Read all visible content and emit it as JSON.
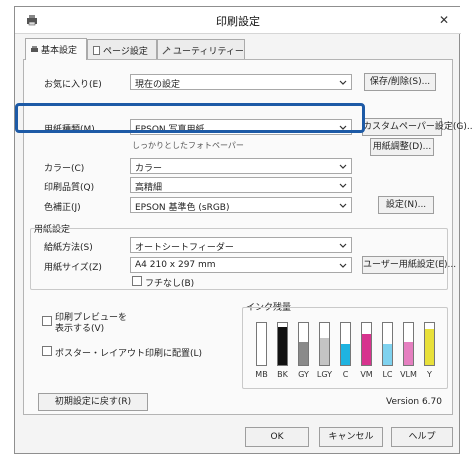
{
  "window": {
    "title": "印刷設定",
    "close_glyph": "✕"
  },
  "tabs": [
    {
      "label": "基本設定",
      "icon": "printer-icon"
    },
    {
      "label": "ページ設定",
      "icon": "page-icon"
    },
    {
      "label": "ユーティリティー",
      "icon": "tools-icon"
    }
  ],
  "main": {
    "favorites_label": "お気に入り(E)",
    "favorites_value": "現在の設定",
    "save_delete_button": "保存/削除(S)...",
    "paper_type_label": "用紙種類(M)",
    "paper_type_value": "EPSON 写真用紙",
    "custom_paper_button": "カスタムペーパー設定(G)...",
    "paper_sub_note": "しっかりとしたフォトペーパー",
    "paper_adjust_button": "用紙調整(D)...",
    "color_label": "カラー(C)",
    "color_value": "カラー",
    "quality_label": "印刷品質(Q)",
    "quality_value": "高精細",
    "color_mode_label": "色補正(J)",
    "color_mode_value": "EPSON 基準色 (sRGB)",
    "settings_button": "設定(N)..."
  },
  "paper_settings": {
    "group_label": "用紙設定",
    "source_label": "給紙方法(S)",
    "source_value": "オートシートフィーダー",
    "size_label": "用紙サイズ(Z)",
    "size_value": "A4 210 x 297 mm",
    "user_size_button": "ユーザー用紙設定(E)...",
    "borderless_label": "フチなし(B)"
  },
  "options": {
    "preview_label_line1": "印刷プレビューを",
    "preview_label_line2": "表示する(V)",
    "layout_label": "ポスター・レイアウト印刷に配置(L)"
  },
  "ink": {
    "title": "インク残量",
    "cartridges": [
      {
        "label": "MB",
        "color": "#1a1a1a",
        "level": 0.0
      },
      {
        "label": "BK",
        "color": "#111111",
        "level": 0.9
      },
      {
        "label": "GY",
        "color": "#8a8a8a",
        "level": 0.55
      },
      {
        "label": "LGY",
        "color": "#c4c4c4",
        "level": 0.65
      },
      {
        "label": "C",
        "color": "#1fb3e0",
        "level": 0.5
      },
      {
        "label": "VM",
        "color": "#d7338e",
        "level": 0.75
      },
      {
        "label": "LC",
        "color": "#7fd2ef",
        "level": 0.5
      },
      {
        "label": "VLM",
        "color": "#e57fc0",
        "level": 0.55
      },
      {
        "label": "Y",
        "color": "#e8e03a",
        "level": 0.85
      }
    ]
  },
  "footer": {
    "reset_button": "初期設定に戻す(R)",
    "version": "Version 6.70",
    "ok_button": "OK",
    "cancel_button": "キャンセル",
    "help_button": "ヘルプ"
  },
  "colors": {
    "highlight": "#1d5aa6"
  }
}
